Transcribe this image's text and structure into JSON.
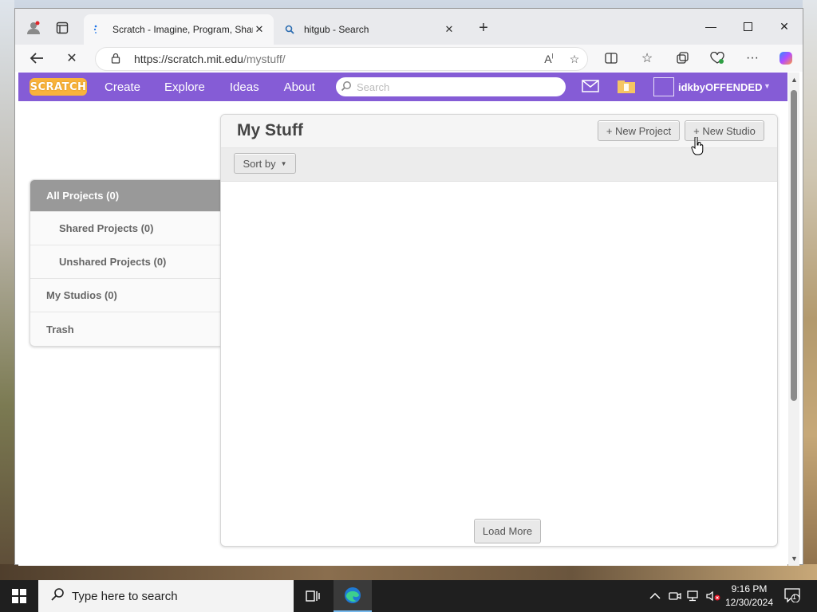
{
  "browser": {
    "tabs": [
      {
        "title": "Scratch - Imagine, Program, Share",
        "active": true
      },
      {
        "title": "hitgub - Search",
        "active": false
      }
    ],
    "url_host": "https://scratch.mit.edu",
    "url_path": "/mystuff/"
  },
  "scratch_nav": {
    "logo": "SCRATCH",
    "links": [
      "Create",
      "Explore",
      "Ideas",
      "About"
    ],
    "search_placeholder": "Search",
    "username": "idkbyOFFENDED"
  },
  "mystuff": {
    "title": "My Stuff",
    "new_project": "+ New Project",
    "new_studio": "+ New Studio",
    "sort_by": "Sort by",
    "load_more": "Load More"
  },
  "sidebar": {
    "items": [
      {
        "label": "All Projects (0)",
        "active": true,
        "sub": false
      },
      {
        "label": "Shared Projects (0)",
        "active": false,
        "sub": true
      },
      {
        "label": "Unshared Projects (0)",
        "active": false,
        "sub": true
      },
      {
        "label": "My Studios (0)",
        "active": false,
        "sub": false
      },
      {
        "label": "Trash",
        "active": false,
        "sub": false
      }
    ]
  },
  "taskbar": {
    "search_placeholder": "Type here to search",
    "time": "9:16 PM",
    "date": "12/30/2024",
    "notification_count": "1"
  },
  "colors": {
    "scratch_purple": "#855cd6",
    "sidebar_active": "#999999"
  }
}
